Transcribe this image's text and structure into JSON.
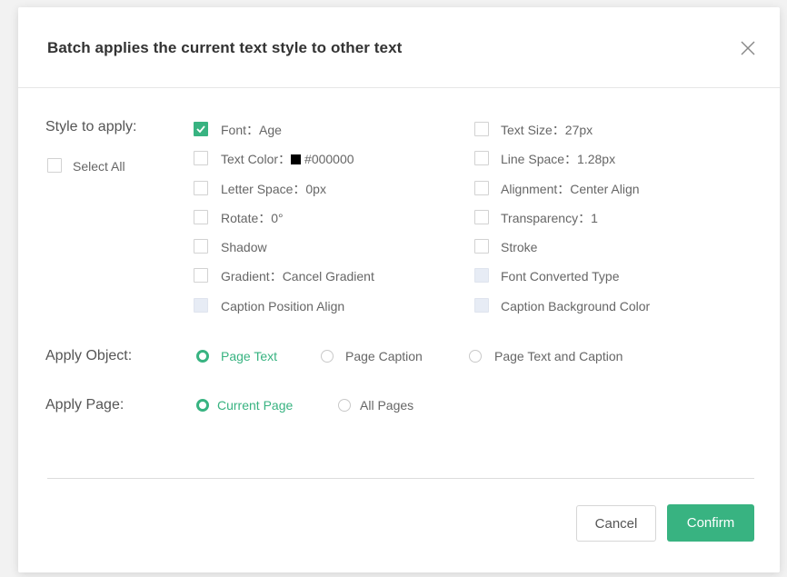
{
  "dialog": {
    "title": "Batch applies the current text style to other text",
    "style_label": "Style to apply:",
    "select_all": "Select All",
    "options_left": [
      {
        "label": "Font：Age",
        "state": "checked"
      },
      {
        "label": "Text Color：",
        "color_value": "#000000",
        "state": "unchecked"
      },
      {
        "label": "Letter Space：0px",
        "state": "unchecked"
      },
      {
        "label": "Rotate：0°",
        "state": "unchecked"
      },
      {
        "label": "Shadow",
        "state": "unchecked"
      },
      {
        "label": "Gradient：Cancel Gradient",
        "state": "unchecked"
      },
      {
        "label": "Caption Position Align",
        "state": "disabled"
      }
    ],
    "options_right": [
      {
        "label": "Text Size：27px",
        "state": "unchecked"
      },
      {
        "label": "Line Space：1.28px",
        "state": "unchecked"
      },
      {
        "label": "Alignment：Center Align",
        "state": "unchecked"
      },
      {
        "label": "Transparency：1",
        "state": "unchecked"
      },
      {
        "label": "Stroke",
        "state": "unchecked"
      },
      {
        "label": "Font Converted Type",
        "state": "disabled"
      },
      {
        "label": "Caption Background Color",
        "state": "disabled"
      }
    ],
    "apply_object_label": "Apply Object:",
    "apply_object_options": [
      "Page Text",
      "Page Caption",
      "Page Text and Caption"
    ],
    "apply_object_selected": "Page Text",
    "apply_page_label": "Apply Page:",
    "apply_page_options": [
      "Current Page",
      "All Pages"
    ],
    "apply_page_selected": "Current Page",
    "cancel": "Cancel",
    "confirm": "Confirm"
  },
  "colors": {
    "accent": "#38b381",
    "text_swatch": "#000000",
    "disabled_checkbox": "#e7ecf5"
  }
}
